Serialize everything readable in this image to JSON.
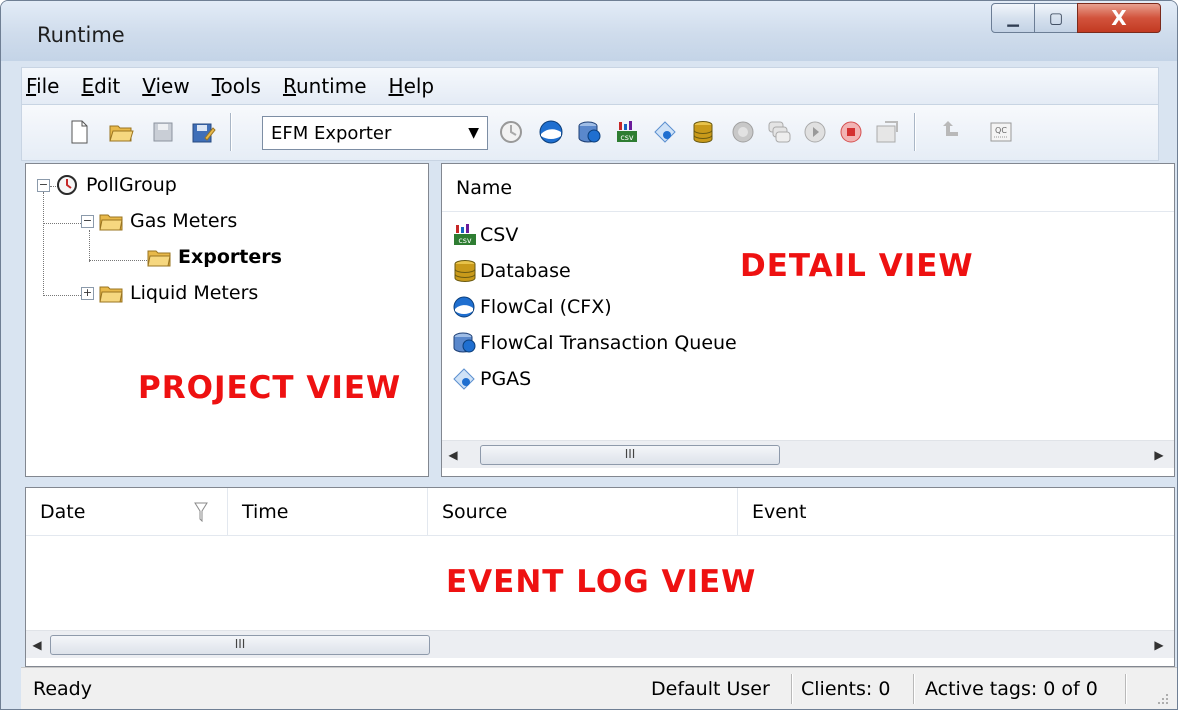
{
  "window": {
    "title": "Runtime",
    "min_glyph": "▁",
    "max_glyph": "▢",
    "close_glyph": "X"
  },
  "menu": [
    "File",
    "Edit",
    "View",
    "Tools",
    "Runtime",
    "Help"
  ],
  "toolbar": {
    "combo_value": "EFM Exporter",
    "combo_arrow": "▼",
    "icons": [
      "new-file-icon",
      "open-folder-icon",
      "save-icon",
      "save-as-icon",
      "pollgroup-icon",
      "flowcal-icon",
      "transaction-queue-icon",
      "csv-icon",
      "pgas-icon",
      "database-icon",
      "disabled-circle-icon",
      "disabled-stack-icon",
      "play-icon",
      "stop-icon",
      "properties-icon",
      "undo-icon",
      "qc-icon"
    ]
  },
  "project_tree": {
    "root": "PollGroup",
    "gas_meters": "Gas Meters",
    "exporters": "Exporters",
    "liquid_meters": "Liquid Meters",
    "collapse_glyph": "−",
    "expand_glyph": "+"
  },
  "detail": {
    "column": "Name",
    "items": [
      "CSV",
      "Database",
      "FlowCal (CFX)",
      "FlowCal Transaction Queue",
      "PGAS"
    ]
  },
  "log": {
    "columns": [
      "Date",
      "Time",
      "Source",
      "Event"
    ]
  },
  "labels": {
    "project_view": "PROJECT VIEW",
    "detail_view": "DETAIL VIEW",
    "event_log_view": "EVENT LOG VIEW"
  },
  "scroll": {
    "left": "◀",
    "right": "▶",
    "thumb": "III"
  },
  "status": {
    "ready": "Ready",
    "user": "Default User",
    "clients": "Clients:  0",
    "active_tags": "Active tags:  0 of 0"
  },
  "colors": {
    "accent_label": "#ee1111",
    "chrome": "#d9e4f1",
    "folder": "#e8b94a"
  }
}
